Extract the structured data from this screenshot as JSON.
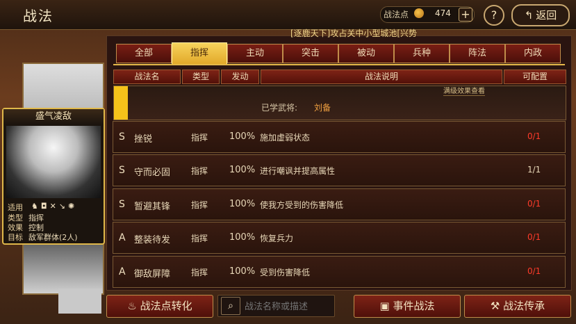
{
  "header": {
    "title": "战法",
    "points_label": "战法点",
    "points_icon": "flame-coin-icon",
    "points_value": "474",
    "plus_label": "+",
    "help_label": "?",
    "back_label": "返回"
  },
  "ticker": "[逐鹿天下]攻占关中小型城池[兴势",
  "tabs": [
    "全部",
    "指挥",
    "主动",
    "突击",
    "被动",
    "兵种",
    "阵法",
    "内政"
  ],
  "active_tab": "指挥",
  "columns": [
    "战法名",
    "类型",
    "发动",
    "战法说明",
    "可配置"
  ],
  "card": {
    "title": "盛气凌敌",
    "labels": [
      "适用",
      "类型",
      "效果",
      "目标"
    ],
    "type": "指挥",
    "effect": "控制",
    "target": "敌军群体(2人)",
    "applicable_icons": [
      "cavalry-icon",
      "shield-icon",
      "crossbow-icon",
      "spear-icon",
      "siege-icon"
    ]
  },
  "learned": {
    "note": "满级效果查看",
    "label": "已学武将:",
    "general": "刘备"
  },
  "skills": [
    {
      "grade": "S",
      "name": "挫锐",
      "type": "指挥",
      "rate": "100%",
      "desc": "施加虚弱状态",
      "cfg": "0/1",
      "cfg_red": true
    },
    {
      "grade": "S",
      "name": "守而必固",
      "type": "指挥",
      "rate": "100%",
      "desc": "进行嘲讽并提高属性",
      "cfg": "1/1",
      "cfg_red": false
    },
    {
      "grade": "S",
      "name": "暂避其锋",
      "type": "指挥",
      "rate": "100%",
      "desc": "使我方受到的伤害降低",
      "cfg": "0/1",
      "cfg_red": true
    },
    {
      "grade": "A",
      "name": "整装待发",
      "type": "指挥",
      "rate": "100%",
      "desc": "恢复兵力",
      "cfg": "0/1",
      "cfg_red": true
    },
    {
      "grade": "A",
      "name": "御敌屏障",
      "type": "指挥",
      "rate": "100%",
      "desc": "受到伤害降低",
      "cfg": "0/1",
      "cfg_red": true
    }
  ],
  "bottom": {
    "convert_label": "战法点转化",
    "search_placeholder": "战法名称或描述",
    "event_label": "事件战法",
    "inherit_label": "战法传承"
  }
}
